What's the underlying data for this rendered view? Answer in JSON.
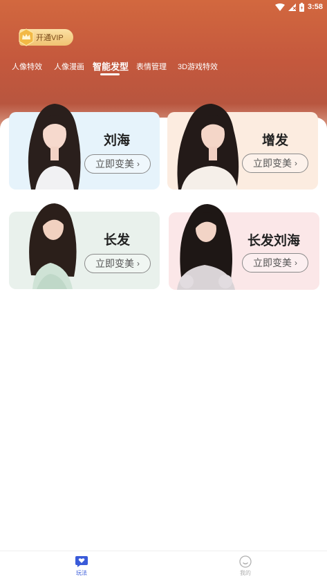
{
  "status_bar": {
    "time": "3:58"
  },
  "vip": {
    "label": "开通VIP"
  },
  "tabs": [
    {
      "label": "人像特效"
    },
    {
      "label": "人像漫画"
    },
    {
      "label": "智能发型"
    },
    {
      "label": "表情管理"
    },
    {
      "label": "3D游戏特效"
    }
  ],
  "cards": [
    {
      "title": "刘海",
      "button": "立即变美",
      "bg": "#e6f3fb"
    },
    {
      "title": "增发",
      "button": "立即变美",
      "bg": "#fcece0"
    },
    {
      "title": "长发",
      "button": "立即变美",
      "bg": "#e9f1ec"
    },
    {
      "title": "长发刘海",
      "button": "立即变美",
      "bg": "#fbe7e8"
    }
  ],
  "bottom_nav": [
    {
      "label": "玩法",
      "icon": "heart-chat-icon",
      "color": "#3a5bd9"
    },
    {
      "label": "我的",
      "icon": "smiley-icon",
      "color": "#b0b0b0"
    }
  ]
}
